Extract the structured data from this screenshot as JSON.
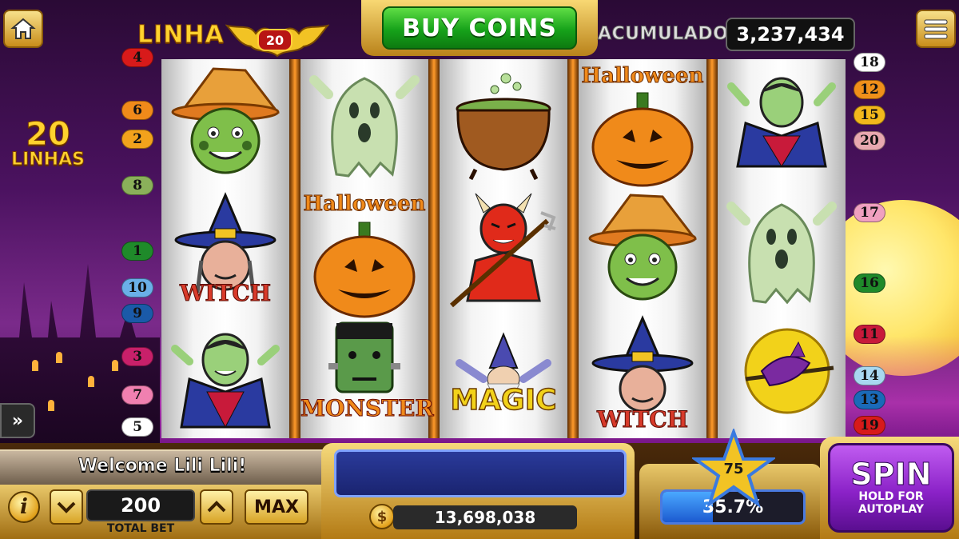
{
  "top_bar": {
    "linha_label": "LINHA",
    "linha_number": "20",
    "buy_coins_label": "BUY COINS",
    "acumulado_label": "ACUMULADO",
    "acumulado_value": "3,237,434"
  },
  "lines_badge": {
    "number": "20",
    "label": "LINHAS"
  },
  "reels": [
    [
      "scarecrow",
      "witch",
      "vampire"
    ],
    [
      "ghost",
      "halloween-pumpkin",
      "monster"
    ],
    [
      "cauldron",
      "devil",
      "magic-wizard"
    ],
    [
      "halloween-pumpkin",
      "scarecrow",
      "witch"
    ],
    [
      "vampire",
      "ghost",
      "flying-witch-moon"
    ]
  ],
  "symbol_text": {
    "witch": "WITCH",
    "halloween": "Halloween",
    "monster": "MONSTER",
    "magic": "MAGIC"
  },
  "left_lines": [
    "4",
    "6",
    "2",
    "8",
    "1",
    "10",
    "9",
    "3",
    "7",
    "5"
  ],
  "right_lines": [
    "18",
    "12",
    "15",
    "20",
    "17",
    "16",
    "11",
    "14",
    "13",
    "19"
  ],
  "line_colors": {
    "1": "#1f8a2a",
    "2": "#f2a21c",
    "3": "#c8206a",
    "4": "#d81a1a",
    "5": "#ffffff",
    "6": "#f08a1a",
    "7": "#f080b0",
    "8": "#8ab05a",
    "9": "#1a5aa8",
    "10": "#6ab0e8",
    "11": "#c81a3a",
    "12": "#f0901a",
    "13": "#1a6ab8",
    "14": "#a8d8f0",
    "15": "#f2b81c",
    "16": "#1f8a2a",
    "17": "#f0a0c0",
    "18": "#ffffff",
    "19": "#d81a1a",
    "20": "#e8a8b0"
  },
  "bottom": {
    "welcome": "Welcome Lili Lili!",
    "info_label": "i",
    "total_bet": "200",
    "total_bet_caption": "TOTAL BET",
    "max_label": "MAX",
    "balance": "13,698,038",
    "coin_symbol": "$",
    "level": "75",
    "progress_text": "35.7%",
    "progress_percent": 35.7,
    "spin_label": "SPIN",
    "spin_sub1": "HOLD FOR",
    "spin_sub2": "AUTOPLAY",
    "expand_label": "»"
  }
}
